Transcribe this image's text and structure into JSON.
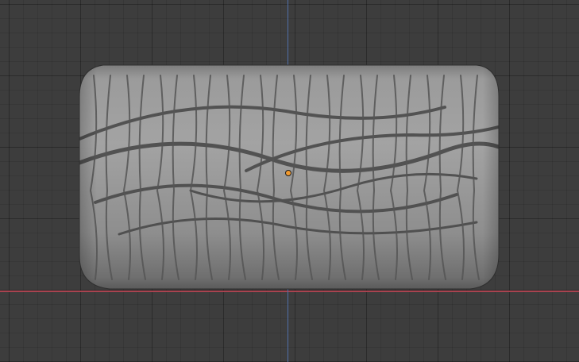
{
  "viewport": {
    "background_color": "#3d3d3d",
    "grid_color": "#2f2f2f",
    "x_axis_color": "#a8434f",
    "z_axis_color": "#4f6fa8"
  },
  "object": {
    "type": "tire",
    "material_color": "#8f8f8f",
    "origin_color": "#f29a2e"
  }
}
